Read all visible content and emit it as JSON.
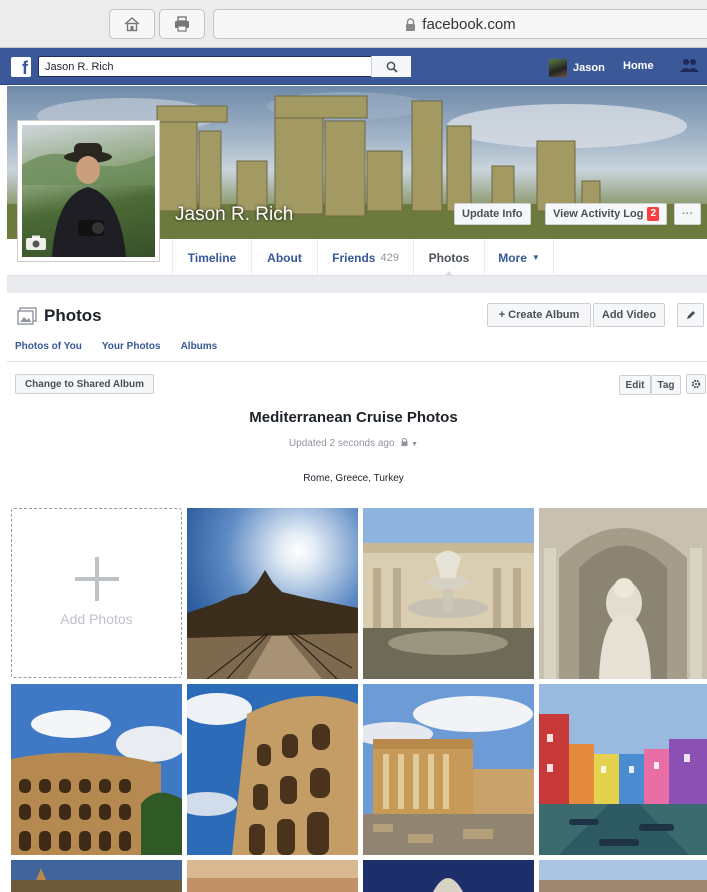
{
  "browser": {
    "url": "facebook.com",
    "home_icon": "home-icon",
    "print_icon": "print-icon",
    "lock_icon": "lock-icon"
  },
  "fb_bar": {
    "search_value": "Jason R. Rich",
    "user_name": "Jason",
    "home_label": "Home",
    "colors": {
      "bar": "#3b5998"
    }
  },
  "profile": {
    "name": "Jason R. Rich",
    "update_info": "Update Info",
    "view_activity_log": "View Activity Log",
    "activity_badge": "2",
    "nav": [
      {
        "label": "Timeline"
      },
      {
        "label": "About"
      },
      {
        "label": "Friends",
        "count": "429"
      },
      {
        "label": "Photos"
      },
      {
        "label": "More"
      }
    ]
  },
  "photos": {
    "title": "Photos",
    "create_album": "+ Create Album",
    "add_video": "Add Video",
    "tabs": [
      "Photos of You",
      "Your Photos",
      "Albums"
    ],
    "change_shared": "Change to Shared Album",
    "edit": "Edit",
    "tag": "Tag"
  },
  "album": {
    "title": "Mediterranean Cruise Photos",
    "updated": "Updated 2 seconds ago",
    "description": "Rome, Greece, Turkey",
    "add_photos": "Add Photos",
    "photos": [
      {
        "icon": "photo-st-peters-sun"
      },
      {
        "icon": "photo-vatican-fountain"
      },
      {
        "icon": "photo-trevi-statue"
      },
      {
        "icon": "photo-colosseum"
      },
      {
        "icon": "photo-colosseum-closeup"
      },
      {
        "icon": "photo-acropolis-ruins"
      },
      {
        "icon": "photo-burano-canal"
      }
    ]
  }
}
